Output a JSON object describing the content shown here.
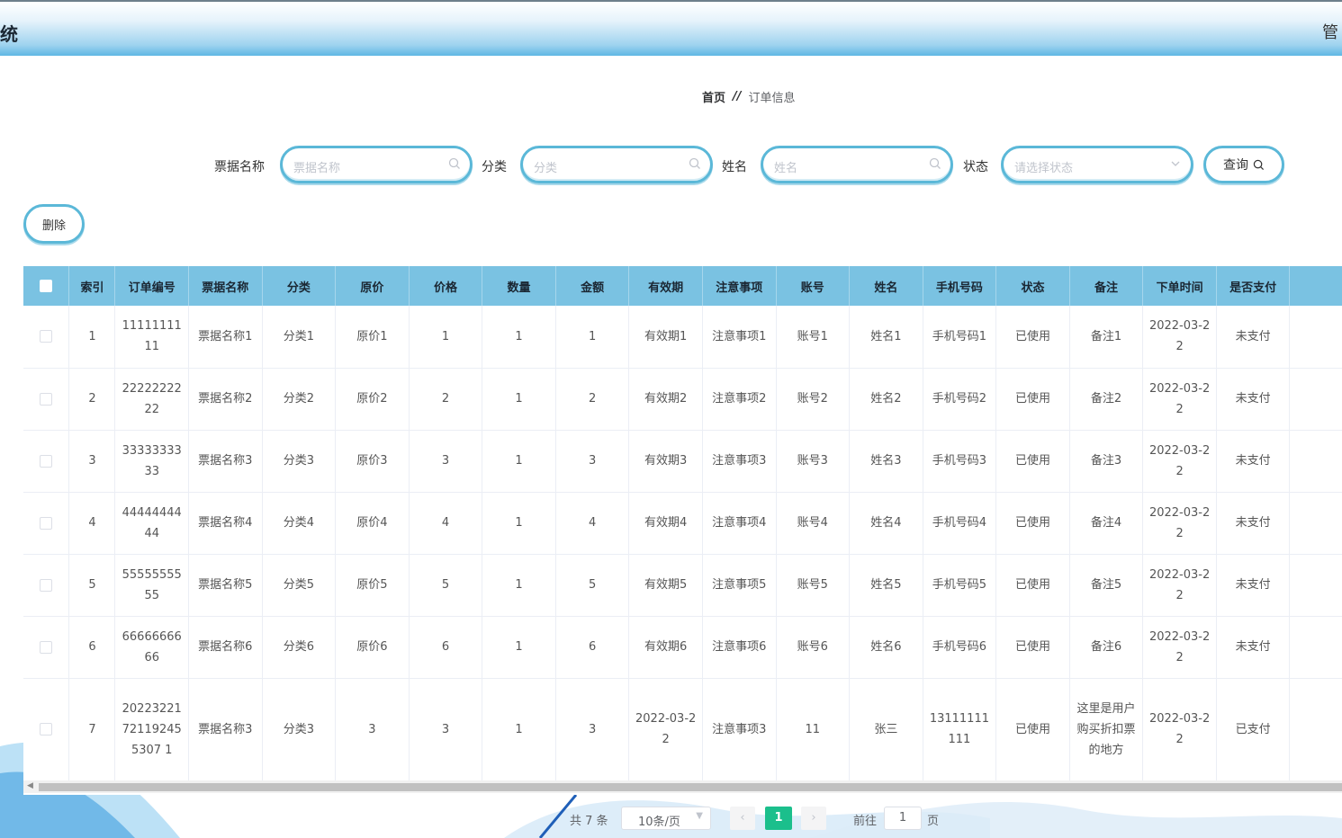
{
  "header": {
    "title": "统",
    "admin": "管"
  },
  "breadcrumb": {
    "home": "首页",
    "sep": "//",
    "current": "订单信息"
  },
  "search": {
    "ticket_label": "票据名称",
    "ticket_placeholder": "票据名称",
    "category_label": "分类",
    "category_placeholder": "分类",
    "name_label": "姓名",
    "name_placeholder": "姓名",
    "status_label": "状态",
    "status_placeholder": "请选择状态",
    "query_label": "查询"
  },
  "actions": {
    "delete_label": "删除"
  },
  "table": {
    "columns": [
      "索引",
      "订单编号",
      "票据名称",
      "分类",
      "原价",
      "价格",
      "数量",
      "金额",
      "有效期",
      "注意事项",
      "账号",
      "姓名",
      "手机号码",
      "状态",
      "备注",
      "下单时间",
      "是否支付"
    ],
    "rows": [
      [
        "1",
        "1111111111",
        "票据名称1",
        "分类1",
        "原价1",
        "1",
        "1",
        "1",
        "有效期1",
        "注意事项1",
        "账号1",
        "姓名1",
        "手机号码1",
        "已使用",
        "备注1",
        "2022-03-22",
        "未支付"
      ],
      [
        "2",
        "2222222222",
        "票据名称2",
        "分类2",
        "原价2",
        "2",
        "1",
        "2",
        "有效期2",
        "注意事项2",
        "账号2",
        "姓名2",
        "手机号码2",
        "已使用",
        "备注2",
        "2022-03-22",
        "未支付"
      ],
      [
        "3",
        "3333333333",
        "票据名称3",
        "分类3",
        "原价3",
        "3",
        "1",
        "3",
        "有效期3",
        "注意事项3",
        "账号3",
        "姓名3",
        "手机号码3",
        "已使用",
        "备注3",
        "2022-03-22",
        "未支付"
      ],
      [
        "4",
        "4444444444",
        "票据名称4",
        "分类4",
        "原价4",
        "4",
        "1",
        "4",
        "有效期4",
        "注意事项4",
        "账号4",
        "姓名4",
        "手机号码4",
        "已使用",
        "备注4",
        "2022-03-22",
        "未支付"
      ],
      [
        "5",
        "5555555555",
        "票据名称5",
        "分类5",
        "原价5",
        "5",
        "1",
        "5",
        "有效期5",
        "注意事项5",
        "账号5",
        "姓名5",
        "手机号码5",
        "已使用",
        "备注5",
        "2022-03-22",
        "未支付"
      ],
      [
        "6",
        "6666666666",
        "票据名称6",
        "分类6",
        "原价6",
        "6",
        "1",
        "6",
        "有效期6",
        "注意事项6",
        "账号6",
        "姓名6",
        "手机号码6",
        "已使用",
        "备注6",
        "2022-03-22",
        "未支付"
      ],
      [
        "7",
        "20223221721192455307 1",
        "票据名称3",
        "分类3",
        "3",
        "3",
        "1",
        "3",
        "2022-03-22",
        "注意事项3",
        "11",
        "张三",
        "13111111111",
        "已使用",
        "这里是用户购买折扣票的地方",
        "2022-03-22",
        "已支付"
      ]
    ]
  },
  "pagination": {
    "total": "共 7 条",
    "page_size": "10条/页",
    "current_page": "1",
    "goto_label": "前往",
    "goto_value": "1",
    "page_suffix": "页"
  },
  "colors": {
    "accent": "#5bb8d8",
    "header_bg": "#7ac2e2",
    "page_active": "#1bbf8c",
    "op_button": "#29a0dc"
  }
}
